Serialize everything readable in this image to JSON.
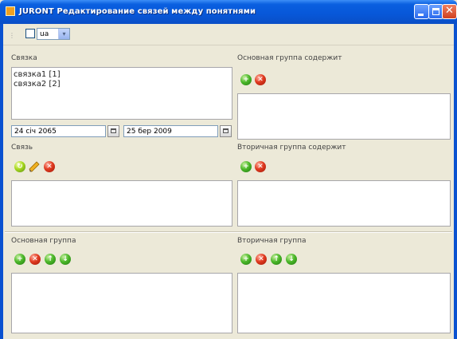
{
  "window": {
    "title": "JURONT Редактирование связей между понятнями",
    "minimize_glyph": "",
    "maximize_glyph": "",
    "close_glyph": "✕"
  },
  "toolbar": {
    "language_value": "ua",
    "dropdown_arrow": "▾"
  },
  "links_panel": {
    "label": "Связка",
    "items": [
      "связка1 [1]",
      "связка2 [2]"
    ],
    "date_from": "24 січ 2065",
    "date_to": "25 бер 2009"
  },
  "link_panel": {
    "label": "Связь"
  },
  "main_group_contains": {
    "label": "Основная группа содержит"
  },
  "secondary_group_contains": {
    "label": "Вторичная группа содержит"
  },
  "main_group": {
    "label": "Основная группа"
  },
  "secondary_group": {
    "label": "Вторичная группа"
  },
  "icons": {
    "add": "add-icon",
    "remove": "remove-icon",
    "edit": "pencil-icon",
    "move_up": "arrow-up-icon",
    "move_down": "arrow-down-icon",
    "refresh": "refresh-icon",
    "calendar": "calendar-icon"
  },
  "colors": {
    "title_bar": "#0757d8",
    "window_bg": "#ece9d8",
    "add_green": "#4cb82a",
    "remove_red": "#e03a20"
  }
}
